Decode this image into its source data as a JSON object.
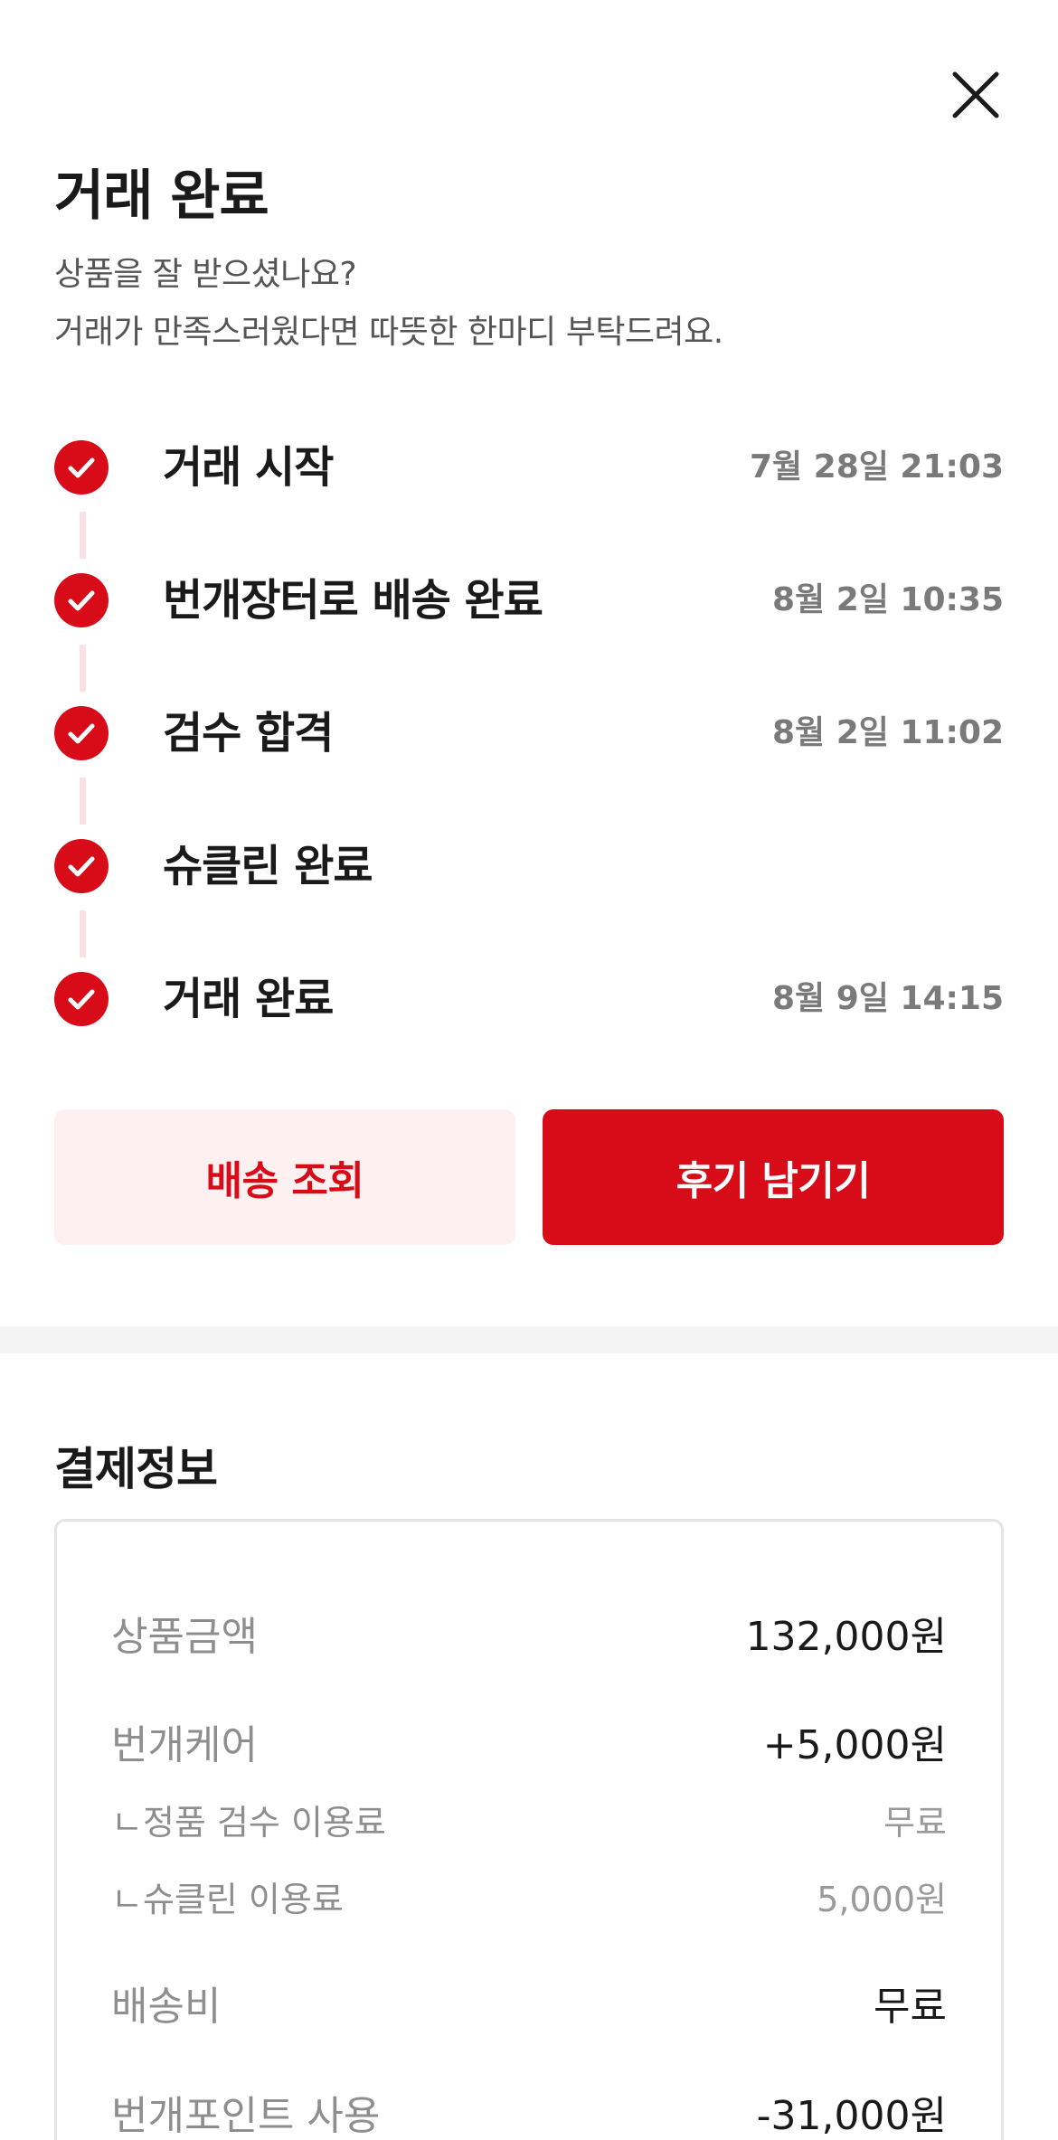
{
  "header": {
    "title": "거래 완료",
    "subtitle_line1": "상품을 잘 받으셨나요?",
    "subtitle_line2": "거래가 만족스러웠다면 따뜻한 한마디 부탁드려요."
  },
  "timeline": {
    "steps": [
      {
        "label": "거래 시작",
        "time": "7월 28일 21:03"
      },
      {
        "label": "번개장터로 배송 완료",
        "time": "8월 2일 10:35"
      },
      {
        "label": "검수 합격",
        "time": "8월 2일 11:02"
      },
      {
        "label": "슈클린 완료",
        "time": ""
      },
      {
        "label": "거래 완료",
        "time": "8월 9일 14:15"
      }
    ]
  },
  "actions": {
    "track_label": "배송 조회",
    "review_label": "후기 남기기"
  },
  "payment": {
    "title": "결제정보",
    "rows": [
      {
        "key": "상품금액",
        "value": "132,000원"
      },
      {
        "key": "번개케어",
        "value": "+5,000원"
      },
      {
        "key": "ㄴ정품 검수 이용료",
        "value": "무료"
      },
      {
        "key": "ㄴ슈클린 이용료",
        "value": "5,000원"
      },
      {
        "key": "배송비",
        "value": "무료"
      },
      {
        "key": "번개포인트 사용",
        "value": "-31,000원"
      }
    ]
  },
  "colors": {
    "accent": "#d80c18",
    "accent_light": "#fdf0f0",
    "connector": "#fbe1e3",
    "muted_text": "#7a7a7a"
  },
  "icons": {
    "close": "close-icon",
    "step": "check-icon"
  }
}
